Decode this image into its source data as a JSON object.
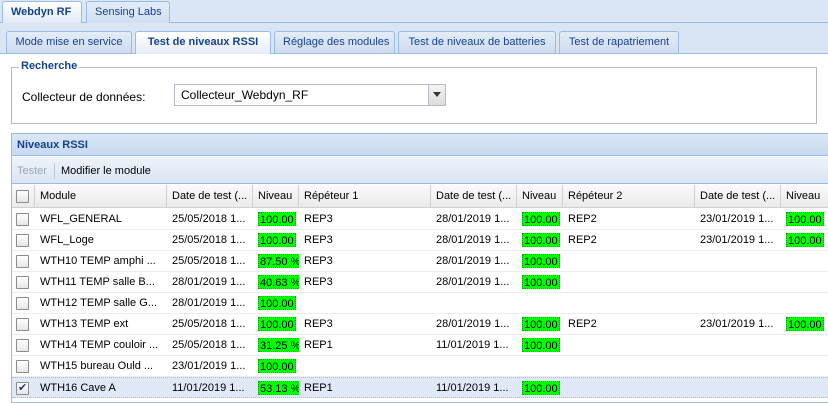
{
  "app_tabs": [
    "Webdyn RF",
    "Sensing Labs"
  ],
  "sub_tabs": [
    "Mode mise en service",
    "Test de niveaux RSSI",
    "Réglage des modules",
    "Test de niveaux de batteries",
    "Test de rapatriement"
  ],
  "recherche": {
    "legend": "Recherche",
    "collector_label": "Collecteur de données:",
    "collector_value": "Collecteur_Webdyn_RF"
  },
  "panel": {
    "title": "Niveaux RSSI",
    "toolbar": {
      "tester": "Tester",
      "modifier": "Modifier le module"
    }
  },
  "grid": {
    "columns": [
      "Module",
      "Date de test (...",
      "Niveau",
      "Répéteur 1",
      "Date de test (...",
      "Niveau",
      "Répéteur 2",
      "Date de test (...",
      "Niveau"
    ],
    "rows": [
      {
        "checked": false,
        "module": "WFL_GENERAL",
        "date0": "25/05/2018 1...",
        "lvl0": "100.00",
        "rep1": "REP3",
        "date1": "28/01/2019 1...",
        "lvl1": "100.00",
        "rep2": "REP2",
        "date2": "23/01/2019 1...",
        "lvl2": "100.00"
      },
      {
        "checked": false,
        "module": "WFL_Loge",
        "date0": "25/05/2018 1...",
        "lvl0": "100.00",
        "rep1": "REP3",
        "date1": "28/01/2019 1...",
        "lvl1": "100.00",
        "rep2": "REP2",
        "date2": "23/01/2019 1...",
        "lvl2": "100.00"
      },
      {
        "checked": false,
        "module": "WTH10 TEMP amphi ...",
        "date0": "25/05/2018 1...",
        "lvl0": "87.50 %",
        "rep1": "REP3",
        "date1": "28/01/2019 1...",
        "lvl1": "100.00",
        "rep2": "",
        "date2": "",
        "lvl2": ""
      },
      {
        "checked": false,
        "module": "WTH11 TEMP salle B...",
        "date0": "28/01/2019 1...",
        "lvl0": "40.63 %",
        "rep1": "REP3",
        "date1": "28/01/2019 1...",
        "lvl1": "100.00",
        "rep2": "",
        "date2": "",
        "lvl2": ""
      },
      {
        "checked": false,
        "module": "WTH12 TEMP salle G...",
        "date0": "28/01/2019 1...",
        "lvl0": "100.00",
        "rep1": "",
        "date1": "",
        "lvl1": "",
        "rep2": "",
        "date2": "",
        "lvl2": ""
      },
      {
        "checked": false,
        "module": "WTH13 TEMP ext",
        "date0": "25/05/2018 1...",
        "lvl0": "100.00",
        "rep1": "REP3",
        "date1": "28/01/2019 1...",
        "lvl1": "100.00",
        "rep2": "REP2",
        "date2": "23/01/2019 1...",
        "lvl2": "100.00"
      },
      {
        "checked": false,
        "module": "WTH14 TEMP couloir ...",
        "date0": "25/05/2018 1...",
        "lvl0": "31.25 %",
        "rep1": "REP1",
        "date1": "11/01/2019 1...",
        "lvl1": "100.00",
        "rep2": "",
        "date2": "",
        "lvl2": ""
      },
      {
        "checked": false,
        "module": "WTH15 bureau Ould ...",
        "date0": "23/01/2019 1...",
        "lvl0": "100.00",
        "rep1": "",
        "date1": "",
        "lvl1": "",
        "rep2": "",
        "date2": "",
        "lvl2": ""
      },
      {
        "checked": true,
        "module": "WTH16 Cave A",
        "date0": "11/01/2019 1...",
        "lvl0": "53.13 %",
        "rep1": "REP1",
        "date1": "11/01/2019 1...",
        "lvl1": "100.00",
        "rep2": "",
        "date2": "",
        "lvl2": ""
      }
    ]
  },
  "colors": {
    "accent": "#15428b",
    "level_fill": "#00ff00",
    "border": "#99bbe8"
  },
  "icons": {
    "combo_trigger": "chevron-down-icon",
    "row_select": "checkbox-icon"
  }
}
